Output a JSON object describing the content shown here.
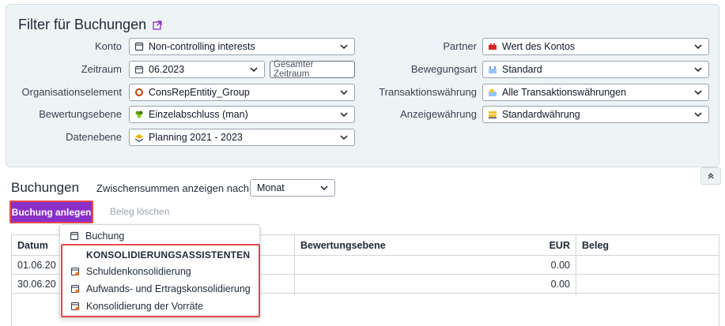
{
  "filter": {
    "title": "Filter für Buchungen",
    "konto": {
      "label": "Konto",
      "value": "Non-controlling interests"
    },
    "zeitraum": {
      "label": "Zeitraum",
      "value": "06.2023",
      "button": "Gesamter Zeitraum"
    },
    "organisationselement": {
      "label": "Organisationselement",
      "value": "ConsRepEntitiy_Group"
    },
    "bewertungsebene": {
      "label": "Bewertungsebene",
      "value": "Einzelabschluss (man)"
    },
    "datenebene": {
      "label": "Datenebene",
      "value": "Planning 2021 - 2023"
    },
    "partner": {
      "label": "Partner",
      "value": "Wert des Kontos"
    },
    "bewegungsart": {
      "label": "Bewegungsart",
      "value": "Standard"
    },
    "transaktionswaehrung": {
      "label": "Transaktionswährung",
      "value": "Alle Transaktionswährungen"
    },
    "anzeigewaehrung": {
      "label": "Anzeigewährung",
      "value": "Standardwährung"
    }
  },
  "buchungen": {
    "title": "Buchungen",
    "zwischensummen_label": "Zwischensummen anzeigen nach",
    "zwischensummen_value": "Monat",
    "create_button": "Buchung anlegen",
    "delete_button": "Beleg löschen"
  },
  "table": {
    "headers": {
      "datum": "Datum",
      "bewertungsebene": "Bewertungsebene",
      "eur": "EUR",
      "beleg": "Beleg"
    },
    "rows": [
      {
        "datum": "01.06.20",
        "eur": "0.00"
      },
      {
        "datum": "30.06.20",
        "eur": "0.00"
      }
    ]
  },
  "menu": {
    "item_buchung": "Buchung",
    "group_heading": "KONSOLIDIERUNGSASSISTENTEN",
    "items": [
      "Schuldenkonsolidierung",
      "Aufwands- und Ertragskonsolidierung",
      "Konsolidierung der Vorräte"
    ]
  },
  "colors": {
    "accent": "#8b2fc9",
    "highlight": "#e5484d",
    "panel": "#eef4f6"
  }
}
